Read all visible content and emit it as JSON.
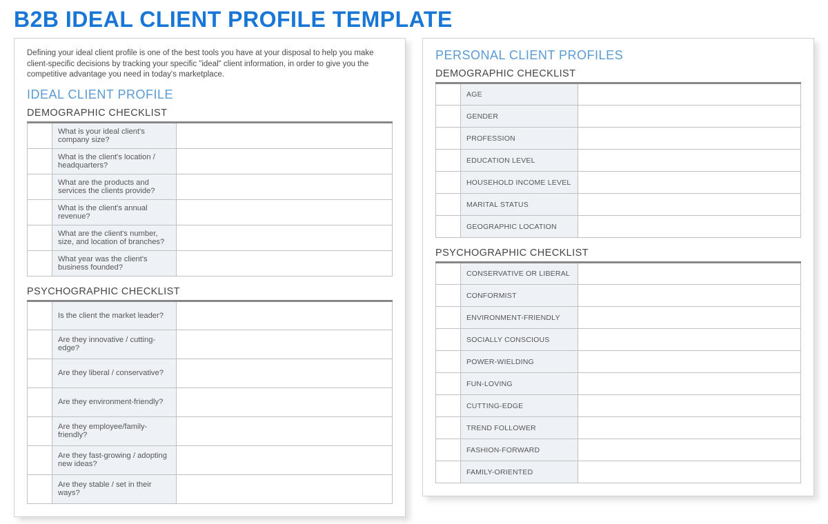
{
  "page_title": "B2B IDEAL CLIENT PROFILE TEMPLATE",
  "left": {
    "intro": "Defining your ideal client profile is one of the best tools you have at your disposal to help you make client-specific decisions by tracking your specific \"ideal\" client information, in order to give you the competitive advantage you need in today's marketplace.",
    "section1_title": "IDEAL CLIENT PROFILE",
    "demo_title": "DEMOGRAPHIC CHECKLIST",
    "demo_rows": [
      "What is your ideal client's company size?",
      "What is the client's location / headquarters?",
      "What are the products and services the clients provide?",
      "What is the client's annual revenue?",
      "What are the client's number, size, and location of branches?",
      "What year was the client's business founded?"
    ],
    "psych_title": "PSYCHOGRAPHIC CHECKLIST",
    "psych_rows": [
      "Is the client the market leader?",
      "Are they innovative / cutting-edge?",
      "Are they liberal / conservative?",
      "Are they environment-friendly?",
      "Are they employee/family-friendly?",
      "Are they fast-growing / adopting new ideas?",
      "Are they stable / set in their ways?"
    ]
  },
  "right": {
    "section_title": "PERSONAL CLIENT PROFILES",
    "demo_title": "DEMOGRAPHIC CHECKLIST",
    "demo_rows": [
      "AGE",
      "GENDER",
      "PROFESSION",
      "EDUCATION LEVEL",
      "HOUSEHOLD INCOME LEVEL",
      "MARITAL STATUS",
      "GEOGRAPHIC LOCATION"
    ],
    "psych_title": "PSYCHOGRAPHIC CHECKLIST",
    "psych_rows": [
      "CONSERVATIVE OR LIBERAL",
      "CONFORMIST",
      "ENVIRONMENT-FRIENDLY",
      "SOCIALLY CONSCIOUS",
      "POWER-WIELDING",
      "FUN-LOVING",
      "CUTTING-EDGE",
      "TREND FOLLOWER",
      "FASHION-FORWARD",
      "FAMILY-ORIENTED"
    ]
  }
}
